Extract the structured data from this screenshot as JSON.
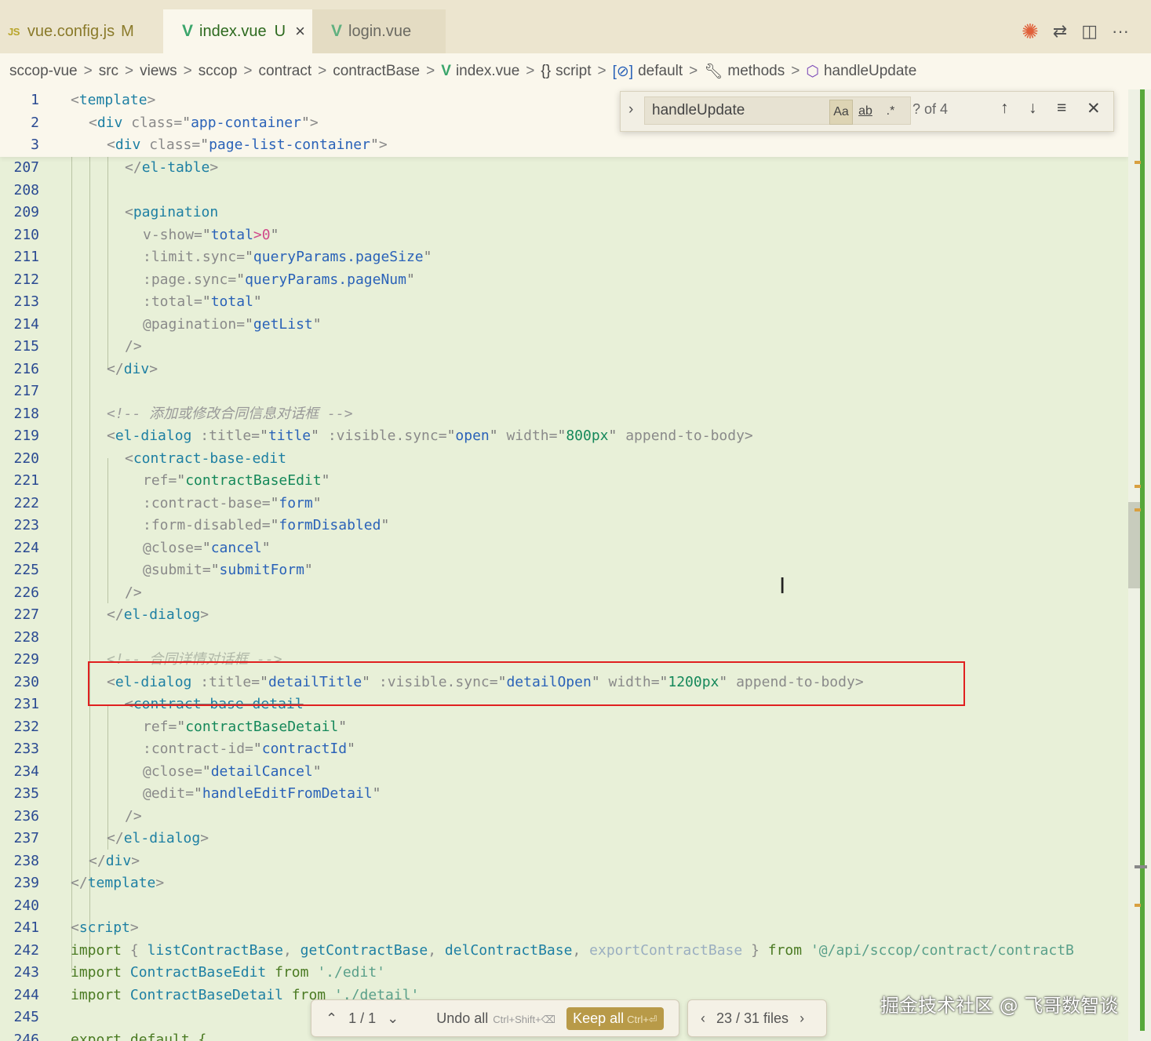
{
  "tabs": [
    {
      "logo": "JS",
      "label": "vue.config.js",
      "badge": "M"
    },
    {
      "logo": "V",
      "label": "index.vue",
      "badge": "U",
      "close": "×"
    },
    {
      "logo": "V",
      "label": "login.vue"
    }
  ],
  "tab_icons": [
    "copilot-spark-icon",
    "git-compare-icon",
    "split-editor-icon",
    "more-icon"
  ],
  "breadcrumb": {
    "items": [
      "sccop-vue",
      "src",
      "views",
      "sccop",
      "contract",
      "contractBase"
    ],
    "file": "index.vue",
    "script": "script",
    "default": "default",
    "methods": "methods",
    "handle": "handleUpdate",
    "script_icon": "{}",
    "sep": ">"
  },
  "find": {
    "value": "handleUpdate",
    "match_case": "Aa",
    "whole_word": "ab",
    "regex": ".*",
    "count": "? of 4"
  },
  "lines": {
    "1": "1",
    "2": "2",
    "3": "3",
    "207": "207",
    "208": "208",
    "209": "209",
    "210": "210",
    "211": "211",
    "212": "212",
    "213": "213",
    "214": "214",
    "215": "215",
    "216": "216",
    "217": "217",
    "218": "218",
    "219": "219",
    "220": "220",
    "221": "221",
    "222": "222",
    "223": "223",
    "224": "224",
    "225": "225",
    "226": "226",
    "227": "227",
    "228": "228",
    "229": "229",
    "230": "230",
    "231": "231",
    "232": "232",
    "233": "233",
    "234": "234",
    "235": "235",
    "236": "236",
    "237": "237",
    "238": "238",
    "239": "239",
    "240": "240",
    "241": "241",
    "242": "242",
    "243": "243",
    "244": "244",
    "245": "245",
    "246": "246"
  },
  "code": {
    "template": "template",
    "div": "div",
    "class_attr": "class",
    "app_container": "app-container",
    "page_list_container": "page-list-container",
    "el_table": "el-table",
    "pagination": "pagination",
    "v_show": "v-show",
    "total": "total",
    "zero": "0",
    "limit_sync": ":limit.sync",
    "page_size": "queryParams.pageSize",
    "page_sync": ":page.sync",
    "page_num": "queryParams.pageNum",
    "total_attr": ":total",
    "pagination_evt": "@pagination",
    "get_list": "getList",
    "comment1": "<!-- 添加或修改合同信息对话框 -->",
    "el_dialog": "el-dialog",
    "title_attr": ":title",
    "title_val": "title",
    "visible_attr": ":visible.sync",
    "open_val": "open",
    "width_attr": "width",
    "w800": "800px",
    "append": "append-to-body",
    "cbe": "contract-base-edit",
    "ref_attr": "ref",
    "cbe_ref": "contractBaseEdit",
    "contract_base_attr": ":contract-base",
    "form_val": "form",
    "form_disabled_attr": ":form-disabled",
    "form_disabled_val": "formDisabled",
    "close_evt": "@close",
    "cancel_val": "cancel",
    "submit_evt": "@submit",
    "submit_val": "submitForm",
    "comment2": "<!-- 合同详情对话框 -->",
    "detail_title": "detailTitle",
    "detail_open": "detailOpen",
    "w1200": "1200px",
    "cbd": "contract-base-detail",
    "cbd_ref": "contractBaseDetail",
    "contract_id_attr": ":contract-id",
    "contract_id_val": "contractId",
    "detail_cancel": "detailCancel",
    "edit_evt": "@edit",
    "edit_val": "handleEditFromDetail",
    "script": "script",
    "import": "import",
    "from": "from",
    "list_cb": "listContractBase",
    "get_cb": "getContractBase",
    "del_cb": "delContractBase",
    "export_cb": "exportContractBase",
    "api_path": "'@/api/sccop/contract/contractB",
    "cbe_comp": "ContractBaseEdit",
    "edit_path": "'./edit'",
    "cbd_comp": "ContractBaseDetail",
    "detail_path": "'./detail'",
    "export_default": "export default {"
  },
  "bottom": {
    "pager": "1 / 1",
    "undo": "Undo all",
    "undo_sc": "Ctrl+Shift+⌫",
    "keep": "Keep all",
    "keep_sc": "Ctrl+⏎",
    "files": "23 / 31 files"
  },
  "watermark": "掘金技术社区 @ 飞哥数智谈",
  "colors": {
    "accent_green": "#57a83a",
    "highlight_red": "#e02020",
    "keep_button": "#b89a48"
  }
}
